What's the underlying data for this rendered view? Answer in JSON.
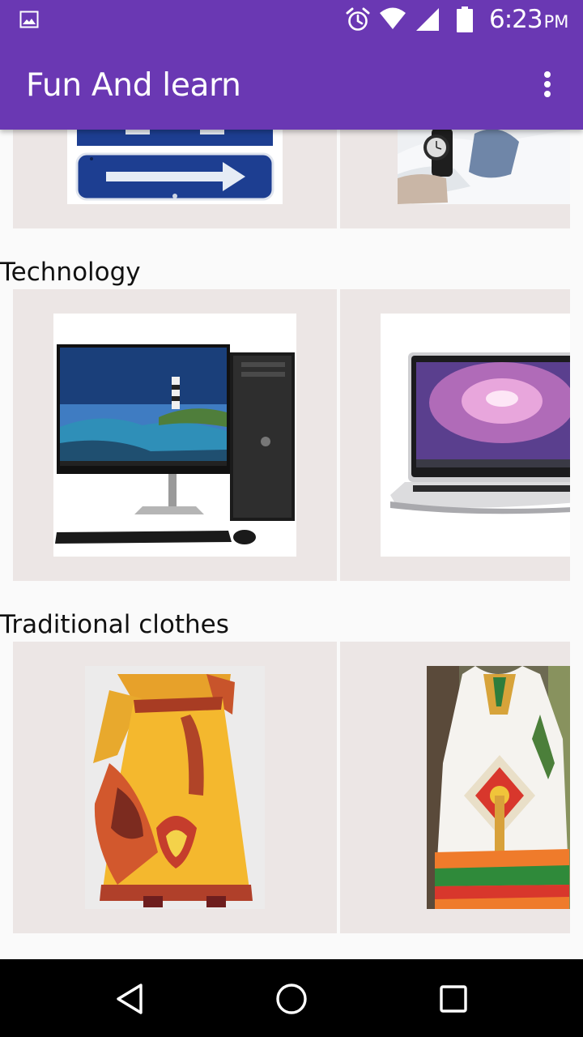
{
  "status_bar": {
    "time": "6:23",
    "ampm": "PM",
    "icons": [
      "gallery-icon",
      "alarm-icon",
      "wifi-icon",
      "cell-signal-icon",
      "battery-icon"
    ]
  },
  "app_bar": {
    "title": "Fun And learn",
    "overflow_icon": "more-vert-icon"
  },
  "sections": [
    {
      "title": "",
      "items": [
        "street-sign-image",
        "wristwatch-image"
      ]
    },
    {
      "title": "Technology",
      "items": [
        "desktop-computer-image",
        "laptop-image"
      ]
    },
    {
      "title": "Traditional clothes",
      "items": [
        "yellow-dress-image",
        "white-dress-image"
      ]
    }
  ],
  "nav_bar": {
    "buttons": [
      "back-icon",
      "home-icon",
      "recents-icon"
    ]
  },
  "colors": {
    "primary": "#6a38b3",
    "card_bg": "#ece6e5",
    "page_bg": "#fafafa"
  }
}
